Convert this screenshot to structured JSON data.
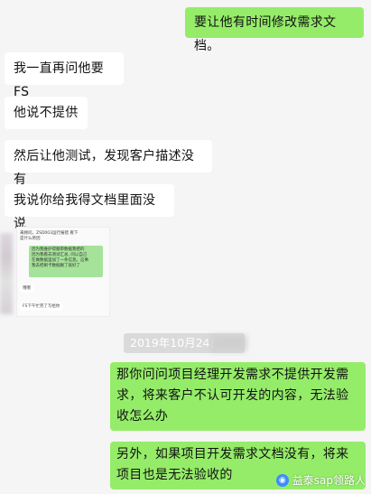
{
  "messages": {
    "m1": "要让他有时间修改需求文档。",
    "m2": "我一直再问他要FS",
    "m3": "他说不提供",
    "m4": "然后让他测试，发现客户描述没有",
    "m5": "我说你给我得文档里面没说",
    "m6": "那你问问项目经理开发需求不提供开发需求，将来客户不认可开发的内容，无法验收怎么办",
    "m7": "另外，如果项目开发需求文档没有，将来项目也是无法验收的"
  },
  "embedded_screenshot": {
    "line1": "来顾问，ZSD003运行报错 看下",
    "line2": "是什么原因",
    "green1": "因为我维护得顺审数据我把的",
    "green2": "因为我看去测试汇总, 问以自己",
    "green3": "在做数据里加了一条信息。这事",
    "green4": "我去把刷卡数据删了就好了",
    "reply": "哦哦",
    "fs_text": "FS下午忙完了写给你"
  },
  "date_label": "2019年10月24日",
  "watermark": {
    "icon": "wechat-official-icon",
    "text": "益泰sap领路人"
  },
  "colors": {
    "right_bubble": "#95ec69",
    "left_bubble": "#ffffff",
    "background": "#f5f5f5"
  }
}
